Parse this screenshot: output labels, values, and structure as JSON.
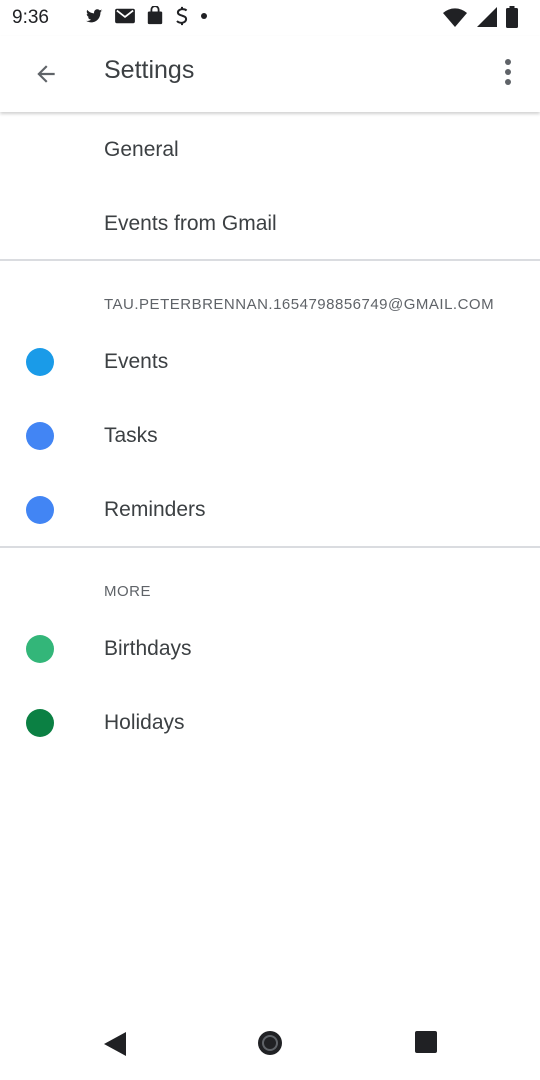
{
  "status_bar": {
    "time": "9:36",
    "notification_icons": [
      "twitter-icon",
      "gmail-icon",
      "shopping-bag-icon",
      "stripe-icon",
      "dot-icon"
    ],
    "system_icons": [
      "wifi-icon",
      "signal-icon",
      "battery-icon"
    ]
  },
  "app_bar": {
    "title": "Settings",
    "back_icon": "arrow-left-icon",
    "more_icon": "more-vert-icon"
  },
  "items_top": [
    {
      "label": "General"
    },
    {
      "label": "Events from Gmail"
    }
  ],
  "account_section": {
    "header": "TAU.PETERBRENNAN.1654798856749@GMAIL.COM",
    "items": [
      {
        "label": "Events",
        "color": "#1a9be8"
      },
      {
        "label": "Tasks",
        "color": "#4285f4"
      },
      {
        "label": "Reminders",
        "color": "#4285f4"
      }
    ]
  },
  "more_section": {
    "header": "MORE",
    "items": [
      {
        "label": "Birthdays",
        "color": "#33b679"
      },
      {
        "label": "Holidays",
        "color": "#0b8043"
      }
    ]
  },
  "nav_bar": {
    "icons": [
      "nav-back-icon",
      "nav-home-icon",
      "nav-recents-icon"
    ]
  }
}
